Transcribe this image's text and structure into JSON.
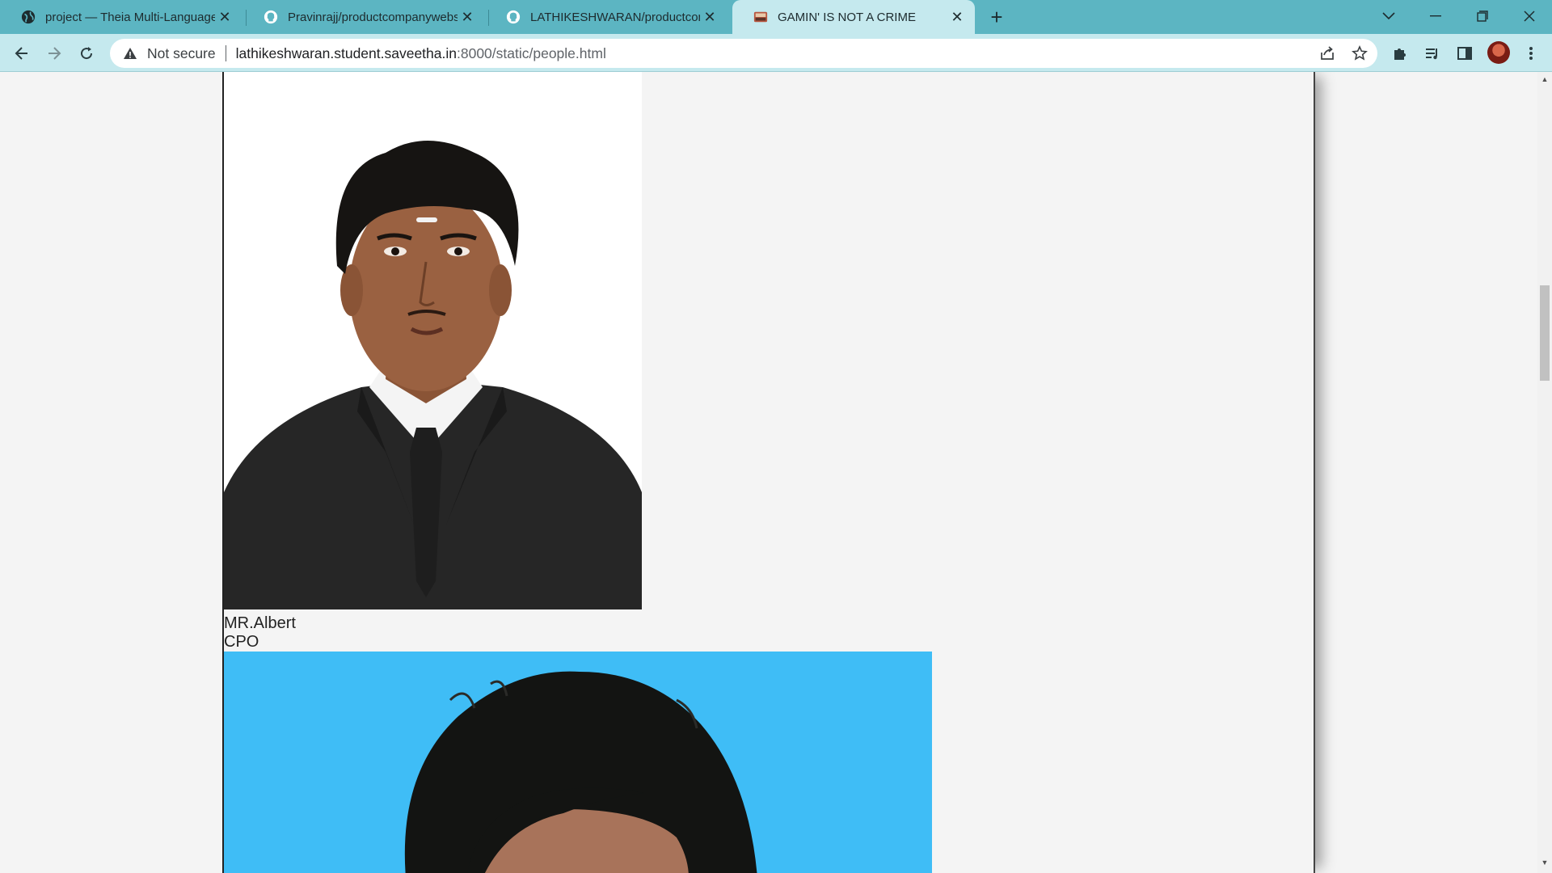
{
  "browser": {
    "tabs": [
      {
        "title": "project — Theia Multi-Language",
        "icon": "globe-icon",
        "active": false
      },
      {
        "title": "Pravinrajj/productcompanywebsi",
        "icon": "github-icon",
        "active": false
      },
      {
        "title": "LATHIKESHWARAN/productcomp",
        "icon": "github-icon",
        "active": false
      },
      {
        "title": "GAMIN' IS NOT A CRIME",
        "icon": "site-favicon",
        "active": true
      }
    ],
    "close_glyph": "✕",
    "new_tab_glyph": "+",
    "address": {
      "security_label": "Not secure",
      "url_host": "lathikeshwaran.student.saveetha.in",
      "url_path": ":8000/static/people.html"
    },
    "colors": {
      "tab_strip": "#5cb5c2",
      "toolbar": "#c5e9ee"
    }
  },
  "page": {
    "people": [
      {
        "name": "MR.Albert",
        "role": "CPO"
      }
    ],
    "colors": {
      "background": "#f4f4f4",
      "photo2_background": "#3fbdf6"
    }
  }
}
